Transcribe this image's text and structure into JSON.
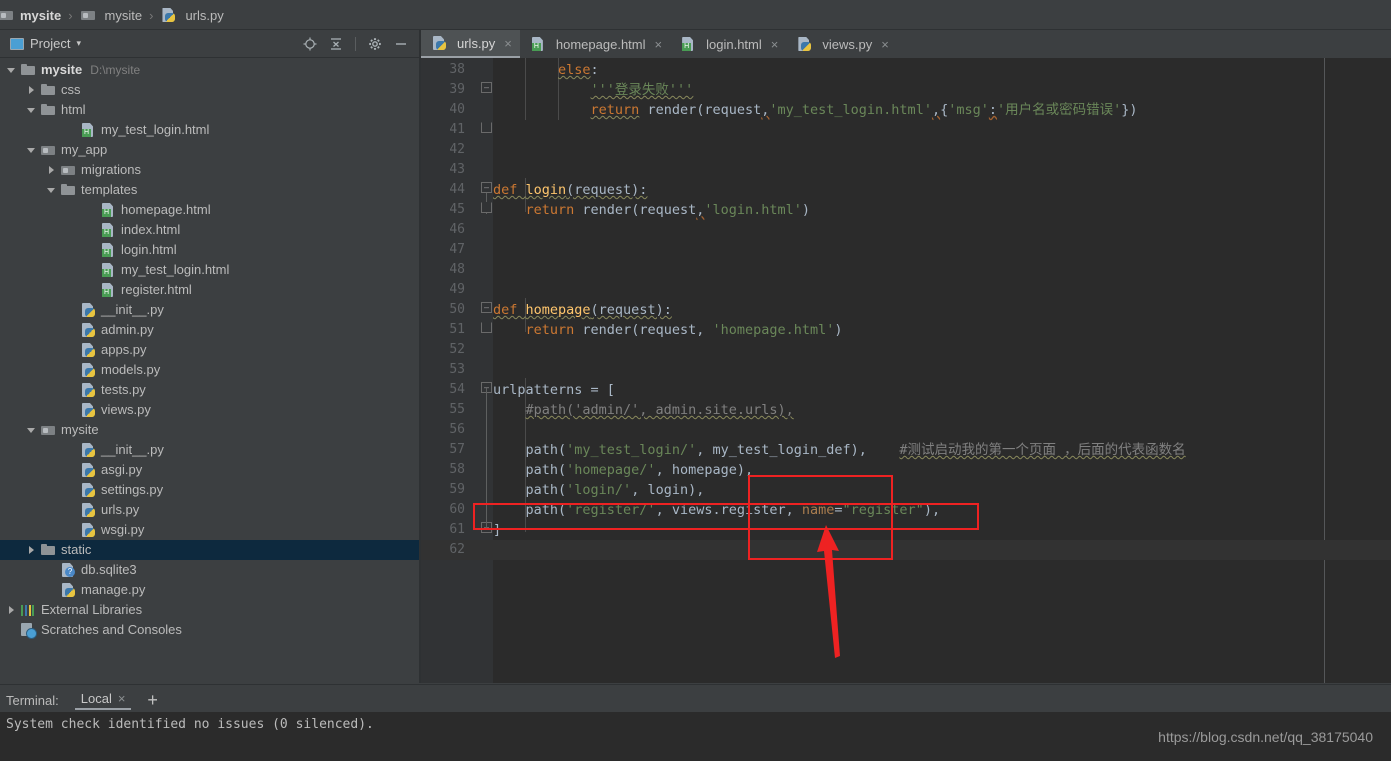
{
  "breadcrumb": {
    "items": [
      {
        "label": "mysite",
        "icon": "module-icon",
        "bold": true
      },
      {
        "label": "mysite",
        "icon": "module-icon",
        "bold": false
      },
      {
        "label": "urls.py",
        "icon": "python-file-icon",
        "bold": false
      }
    ],
    "separator": "›"
  },
  "tool_window": {
    "title": "Project",
    "dropdown_caret": "▾",
    "icons": [
      "locate-target-icon",
      "collapse-all-icon",
      "settings-gear-icon",
      "minimize-icon"
    ]
  },
  "tree": [
    {
      "indent": 0,
      "arrow": "open",
      "icon": "folder-icon",
      "label": "mysite",
      "bold": true,
      "hint": "D:\\mysite"
    },
    {
      "indent": 1,
      "arrow": "closed",
      "icon": "folder-icon",
      "label": "css"
    },
    {
      "indent": 1,
      "arrow": "open",
      "icon": "folder-icon",
      "label": "html"
    },
    {
      "indent": 3,
      "arrow": "none",
      "icon": "html-file-icon",
      "label": "my_test_login.html"
    },
    {
      "indent": 1,
      "arrow": "open",
      "icon": "module-icon",
      "label": "my_app"
    },
    {
      "indent": 2,
      "arrow": "closed",
      "icon": "module-icon",
      "label": "migrations"
    },
    {
      "indent": 2,
      "arrow": "open",
      "icon": "folder-icon",
      "label": "templates"
    },
    {
      "indent": 4,
      "arrow": "none",
      "icon": "html-file-icon",
      "label": "homepage.html"
    },
    {
      "indent": 4,
      "arrow": "none",
      "icon": "html-file-icon",
      "label": "index.html"
    },
    {
      "indent": 4,
      "arrow": "none",
      "icon": "html-file-icon",
      "label": "login.html"
    },
    {
      "indent": 4,
      "arrow": "none",
      "icon": "html-file-icon",
      "label": "my_test_login.html"
    },
    {
      "indent": 4,
      "arrow": "none",
      "icon": "html-file-icon",
      "label": "register.html"
    },
    {
      "indent": 3,
      "arrow": "none",
      "icon": "python-file-icon",
      "label": "__init__.py"
    },
    {
      "indent": 3,
      "arrow": "none",
      "icon": "python-file-icon",
      "label": "admin.py"
    },
    {
      "indent": 3,
      "arrow": "none",
      "icon": "python-file-icon",
      "label": "apps.py"
    },
    {
      "indent": 3,
      "arrow": "none",
      "icon": "python-file-icon",
      "label": "models.py"
    },
    {
      "indent": 3,
      "arrow": "none",
      "icon": "python-file-icon",
      "label": "tests.py"
    },
    {
      "indent": 3,
      "arrow": "none",
      "icon": "python-file-icon",
      "label": "views.py"
    },
    {
      "indent": 1,
      "arrow": "open",
      "icon": "module-icon",
      "label": "mysite"
    },
    {
      "indent": 3,
      "arrow": "none",
      "icon": "python-file-icon",
      "label": "__init__.py"
    },
    {
      "indent": 3,
      "arrow": "none",
      "icon": "python-file-icon",
      "label": "asgi.py"
    },
    {
      "indent": 3,
      "arrow": "none",
      "icon": "python-file-icon",
      "label": "settings.py"
    },
    {
      "indent": 3,
      "arrow": "none",
      "icon": "python-file-icon",
      "label": "urls.py"
    },
    {
      "indent": 3,
      "arrow": "none",
      "icon": "python-file-icon",
      "label": "wsgi.py"
    },
    {
      "indent": 1,
      "arrow": "closed",
      "icon": "folder-icon",
      "label": "static",
      "selected": true
    },
    {
      "indent": 2,
      "arrow": "none",
      "icon": "db-file-icon",
      "label": "db.sqlite3"
    },
    {
      "indent": 2,
      "arrow": "none",
      "icon": "python-file-icon",
      "label": "manage.py"
    },
    {
      "indent": 0,
      "arrow": "closed",
      "icon": "library-icon",
      "label": "External Libraries"
    },
    {
      "indent": 0,
      "arrow": "none",
      "icon": "scratches-icon",
      "label": "Scratches and Consoles"
    }
  ],
  "tabs": [
    {
      "label": "urls.py",
      "icon": "python-file-icon",
      "active": true,
      "close": "×"
    },
    {
      "label": "homepage.html",
      "icon": "html-file-icon",
      "active": false,
      "close": "×"
    },
    {
      "label": "login.html",
      "icon": "html-file-icon",
      "active": false,
      "close": "×"
    },
    {
      "label": "views.py",
      "icon": "python-file-icon",
      "active": false,
      "close": "×"
    }
  ],
  "editor": {
    "first_line": 38,
    "last_line": 62,
    "current_line": 62,
    "lines": [
      {
        "n": 38,
        "segs": [
          {
            "t": "        ",
            "c": "txt"
          },
          {
            "t": "else",
            "c": "kw wavy"
          },
          {
            "t": ":",
            "c": "txt"
          }
        ]
      },
      {
        "n": 39,
        "segs": [
          {
            "t": "            ",
            "c": "txt"
          },
          {
            "t": "'''登录失败'''",
            "c": "str wavy"
          }
        ]
      },
      {
        "n": 40,
        "segs": [
          {
            "t": "            ",
            "c": "txt"
          },
          {
            "t": "return",
            "c": "kw wavy"
          },
          {
            "t": " render(request",
            "c": "txt"
          },
          {
            "t": ",",
            "c": "txt wavy-red"
          },
          {
            "t": "'my_test_login.html'",
            "c": "str"
          },
          {
            "t": ",",
            "c": "txt wavy-red"
          },
          {
            "t": "{",
            "c": "txt"
          },
          {
            "t": "'msg'",
            "c": "str"
          },
          {
            "t": ":",
            "c": "txt wavy-red"
          },
          {
            "t": "'用户名或密码错误'",
            "c": "str"
          },
          {
            "t": "})",
            "c": "txt"
          }
        ]
      },
      {
        "n": 41,
        "segs": []
      },
      {
        "n": 42,
        "segs": []
      },
      {
        "n": 43,
        "segs": []
      },
      {
        "n": 44,
        "segs": [
          {
            "t": "def ",
            "c": "kw wavy"
          },
          {
            "t": "login",
            "c": "fn wavy"
          },
          {
            "t": "(request):",
            "c": "txt wavy"
          }
        ]
      },
      {
        "n": 45,
        "segs": [
          {
            "t": "    ",
            "c": "txt"
          },
          {
            "t": "return",
            "c": "kw"
          },
          {
            "t": " render(request",
            "c": "txt"
          },
          {
            "t": ",",
            "c": "txt wavy-red"
          },
          {
            "t": "'login.html'",
            "c": "str"
          },
          {
            "t": ")",
            "c": "txt"
          }
        ]
      },
      {
        "n": 46,
        "segs": []
      },
      {
        "n": 47,
        "segs": []
      },
      {
        "n": 48,
        "segs": []
      },
      {
        "n": 49,
        "segs": []
      },
      {
        "n": 50,
        "segs": [
          {
            "t": "def ",
            "c": "kw wavy"
          },
          {
            "t": "homepage",
            "c": "fn wavy"
          },
          {
            "t": "(request):",
            "c": "txt wavy"
          }
        ]
      },
      {
        "n": 51,
        "segs": [
          {
            "t": "    ",
            "c": "txt"
          },
          {
            "t": "return",
            "c": "kw"
          },
          {
            "t": " render(request, ",
            "c": "txt"
          },
          {
            "t": "'homepage.html'",
            "c": "str"
          },
          {
            "t": ")",
            "c": "txt"
          }
        ]
      },
      {
        "n": 52,
        "segs": []
      },
      {
        "n": 53,
        "segs": []
      },
      {
        "n": 54,
        "segs": [
          {
            "t": "urlpatterns = [",
            "c": "txt"
          }
        ]
      },
      {
        "n": 55,
        "segs": [
          {
            "t": "    ",
            "c": "txt"
          },
          {
            "t": "#path('admin/', admin.site.urls),",
            "c": "com wavy"
          }
        ]
      },
      {
        "n": 56,
        "segs": []
      },
      {
        "n": 57,
        "segs": [
          {
            "t": "    path(",
            "c": "txt"
          },
          {
            "t": "'my_test_login/'",
            "c": "str"
          },
          {
            "t": ", my_test_login_def)",
            "c": "txt"
          },
          {
            "t": ",",
            "c": "txt"
          },
          {
            "t": "    ",
            "c": "txt"
          },
          {
            "t": "#测试启动我的第一个页面 ，后面的代表函数名",
            "c": "com wavy"
          }
        ]
      },
      {
        "n": 58,
        "segs": [
          {
            "t": "    path(",
            "c": "txt"
          },
          {
            "t": "'homepage/'",
            "c": "str"
          },
          {
            "t": ", homepage),",
            "c": "txt"
          }
        ]
      },
      {
        "n": 59,
        "segs": [
          {
            "t": "    path(",
            "c": "txt"
          },
          {
            "t": "'login/'",
            "c": "str"
          },
          {
            "t": ", login),",
            "c": "txt"
          }
        ]
      },
      {
        "n": 60,
        "segs": [
          {
            "t": "    path(",
            "c": "txt"
          },
          {
            "t": "'register/'",
            "c": "str"
          },
          {
            "t": ", views.register, ",
            "c": "txt"
          },
          {
            "t": "name",
            "c": "namearg"
          },
          {
            "t": "=",
            "c": "txt"
          },
          {
            "t": "\"register\"",
            "c": "str"
          },
          {
            "t": "),",
            "c": "txt"
          }
        ]
      },
      {
        "n": 61,
        "segs": [
          {
            "t": "]",
            "c": "txt"
          }
        ]
      },
      {
        "n": 62,
        "segs": []
      }
    ]
  },
  "annotations": {
    "box_vertical": {
      "name": "red-highlight-box-vertical"
    },
    "box_horizontal": {
      "name": "red-highlight-box-horizontal"
    },
    "arrow": {
      "name": "red-pointer-arrow",
      "color": "#ee2222"
    }
  },
  "terminal": {
    "label": "Terminal:",
    "tab": "Local",
    "tab_close": "×",
    "add": "+",
    "output": "System check identified no issues (0 silenced)."
  },
  "watermark": "https://blog.csdn.net/qq_38175040"
}
